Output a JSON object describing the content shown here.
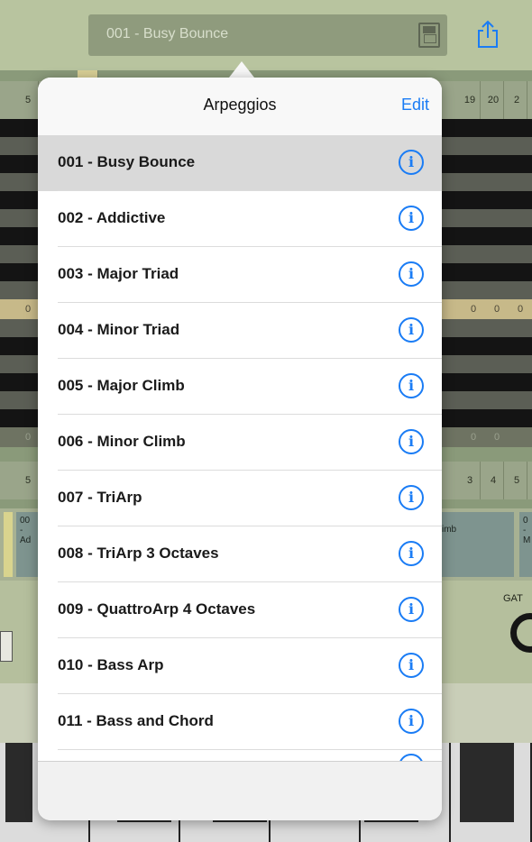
{
  "topbar": {
    "preset_name": "001 - Busy Bounce",
    "save_icon": "save-icon",
    "share_icon": "share-icon"
  },
  "background": {
    "top_numbers": [
      "5",
      "19",
      "20",
      "2"
    ],
    "bottom_numbers": [
      "5",
      "3",
      "4",
      "5"
    ],
    "zero_values": [
      "0",
      "0",
      "0",
      "0"
    ],
    "dim_zero_values": [
      "0",
      "0",
      "0"
    ],
    "bank_tiles": [
      {
        "line1": "00",
        "line2": "-",
        "line3": "Ad"
      },
      {
        "line1": "",
        "line2": "",
        "line3": "imb"
      },
      {
        "line1": "0",
        "line2": "-",
        "line3": "M"
      }
    ],
    "gate_label": "GAT"
  },
  "popover": {
    "title": "Arpeggios",
    "edit_label": "Edit",
    "items": [
      {
        "label": "001 - Busy Bounce",
        "selected": true
      },
      {
        "label": "002 - Addictive",
        "selected": false
      },
      {
        "label": "003 - Major Triad",
        "selected": false
      },
      {
        "label": "004 - Minor Triad",
        "selected": false
      },
      {
        "label": "005 - Major Climb",
        "selected": false
      },
      {
        "label": "006 - Minor Climb",
        "selected": false
      },
      {
        "label": "007 - TriArp",
        "selected": false
      },
      {
        "label": "008 - TriArp 3 Octaves",
        "selected": false
      },
      {
        "label": "009 - QuattroArp 4 Octaves",
        "selected": false
      },
      {
        "label": "010 - Bass Arp",
        "selected": false
      },
      {
        "label": "011 - Bass and Chord",
        "selected": false
      }
    ],
    "info_glyph": "i",
    "accent_color": "#1a7cf5"
  }
}
